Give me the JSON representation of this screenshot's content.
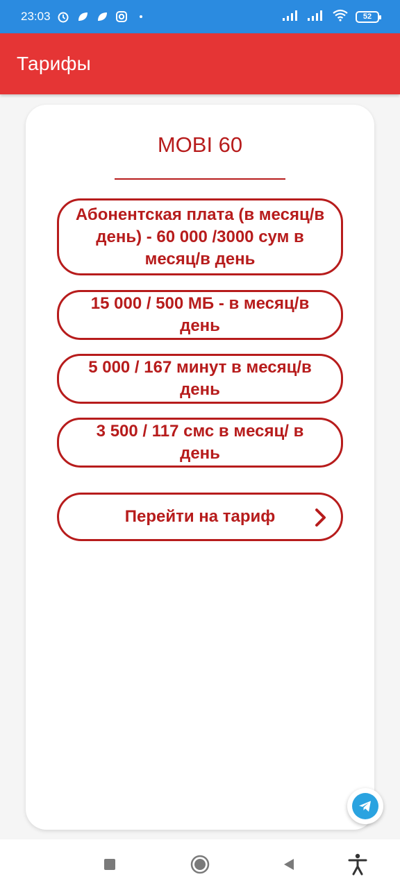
{
  "status_bar": {
    "time": "23:03",
    "battery": "52",
    "icons": [
      "alarm-icon",
      "leaf-icon",
      "leaf-icon",
      "instagram-icon",
      "dot-icon",
      "signal-icon",
      "signal-icon",
      "wifi-icon",
      "battery-icon"
    ]
  },
  "app_bar": {
    "title": "Тарифы"
  },
  "tariff": {
    "name": "MOBI 60",
    "features": [
      {
        "line1": "Абонентская плата (в месяц/в",
        "line2": "день) - 60 000 /3000 сум в",
        "line3": "месяц/в день"
      },
      {
        "line1": "15 000 / 500 МБ - в месяц/в",
        "line2": "день"
      },
      {
        "line1": "5 000 / 167 минут в месяц/в",
        "line2": "день"
      },
      {
        "line1": "3 500 / 117 смс в месяц/ в",
        "line2": "день"
      }
    ],
    "action_label": "Перейти на тариф"
  },
  "colors": {
    "status_bar": "#2b8be0",
    "app_bar": "#e53535",
    "accent": "#b71c1c",
    "telegram": "#2aa3e0"
  }
}
